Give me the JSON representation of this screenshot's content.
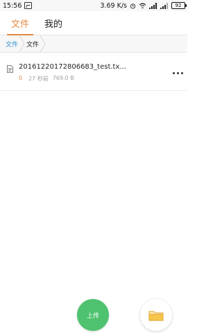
{
  "status_bar": {
    "time": "15:56",
    "network_speed": "3.69 K/s",
    "battery": "92"
  },
  "tabs": [
    {
      "label": "文件",
      "active": true
    },
    {
      "label": "我的",
      "active": false
    }
  ],
  "breadcrumb": {
    "root": "文件",
    "current": "文件"
  },
  "files": [
    {
      "name": "20161220172806683_test.tx...",
      "count": "0",
      "time_ago": "27 秒前",
      "size": "769.0 B"
    }
  ],
  "actions": {
    "upload_label": "上传",
    "folder_icon": "folder-icon"
  },
  "colors": {
    "accent": "#e38a44",
    "link": "#2f8fd3",
    "upload": "#4fc26f"
  }
}
